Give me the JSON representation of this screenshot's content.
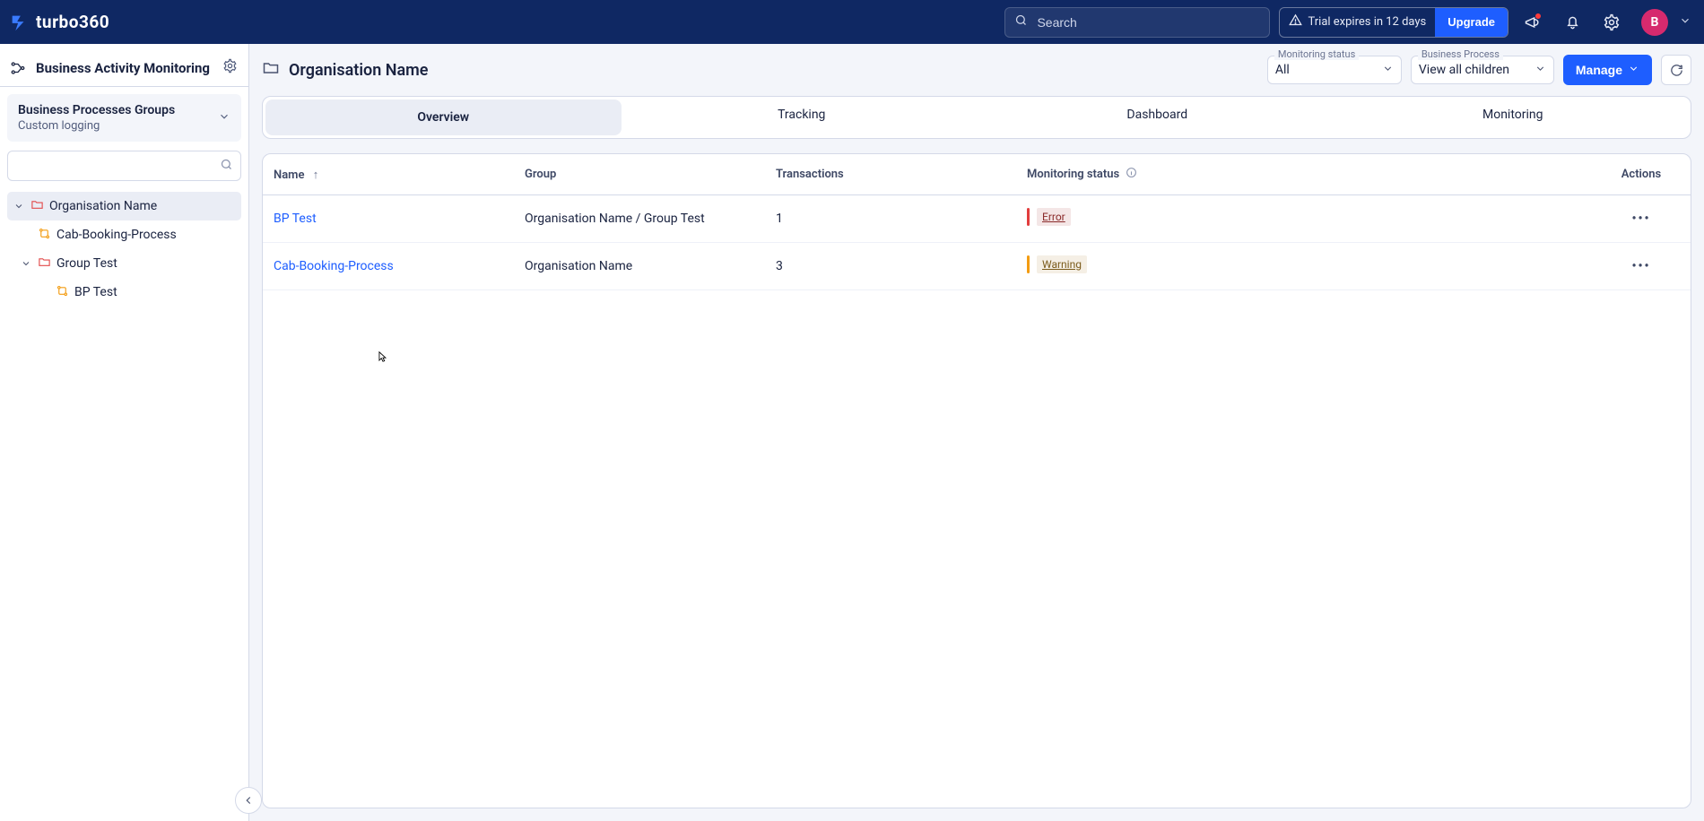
{
  "brand": "turbo360",
  "search": {
    "placeholder": "Search"
  },
  "trial": {
    "message": "Trial expires in 12 days",
    "cta": "Upgrade"
  },
  "avatar_initial": "B",
  "sidebar": {
    "title": "Business Activity Monitoring",
    "group_picker": {
      "line1": "Business Processes Groups",
      "line2": "Custom logging"
    },
    "tree": {
      "root": "Organisation Name",
      "items": [
        {
          "label": "Cab-Booking-Process",
          "icon": "flow"
        },
        {
          "label": "Group Test",
          "icon": "folder",
          "children": [
            {
              "label": "BP Test",
              "icon": "flow"
            }
          ]
        }
      ]
    }
  },
  "breadcrumb": "Organisation Name",
  "filters": {
    "monitoring_label": "Monitoring status",
    "monitoring_value": "All",
    "bp_label": "Business Process",
    "bp_value": "View all children"
  },
  "manage_label": "Manage",
  "tabs": [
    "Overview",
    "Tracking",
    "Dashboard",
    "Monitoring"
  ],
  "active_tab": 0,
  "table": {
    "headers": {
      "name": "Name",
      "group": "Group",
      "transactions": "Transactions",
      "status": "Monitoring status",
      "actions": "Actions"
    },
    "rows": [
      {
        "name": "BP Test",
        "group": "Organisation Name / Group Test",
        "transactions": "1",
        "status": "Error",
        "status_kind": "err"
      },
      {
        "name": "Cab-Booking-Process",
        "group": "Organisation Name",
        "transactions": "3",
        "status": "Warning",
        "status_kind": "warn"
      }
    ]
  }
}
